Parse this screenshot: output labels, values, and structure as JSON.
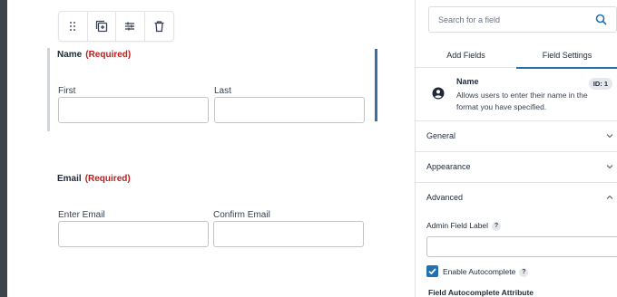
{
  "toolbar": {
    "icons": [
      "drag-handle-icon",
      "duplicate-icon",
      "settings-sliders-icon",
      "trash-icon"
    ]
  },
  "fields": {
    "name": {
      "title": "Name",
      "required": "(Required)",
      "first_label": "First",
      "last_label": "Last"
    },
    "email": {
      "title": "Email",
      "required": "(Required)",
      "enter_label": "Enter Email",
      "confirm_label": "Confirm Email"
    }
  },
  "panel": {
    "search_placeholder": "Search for a field",
    "tabs": {
      "add": "Add Fields",
      "settings": "Field Settings"
    },
    "field_info": {
      "name": "Name",
      "description": "Allows users to enter their name in the format you have specified.",
      "id_badge": "ID: 1"
    },
    "sections": {
      "general": "General",
      "appearance": "Appearance",
      "advanced": "Advanced"
    },
    "advanced": {
      "admin_label": "Admin Field Label",
      "help": "?",
      "enable_autocomplete": "Enable Autocomplete",
      "autocomplete_attr": "Field Autocomplete Attribute"
    }
  },
  "colors": {
    "accent": "#2271b1",
    "required": "#b91c1c",
    "active_field_bar": "#3b6fa0"
  }
}
